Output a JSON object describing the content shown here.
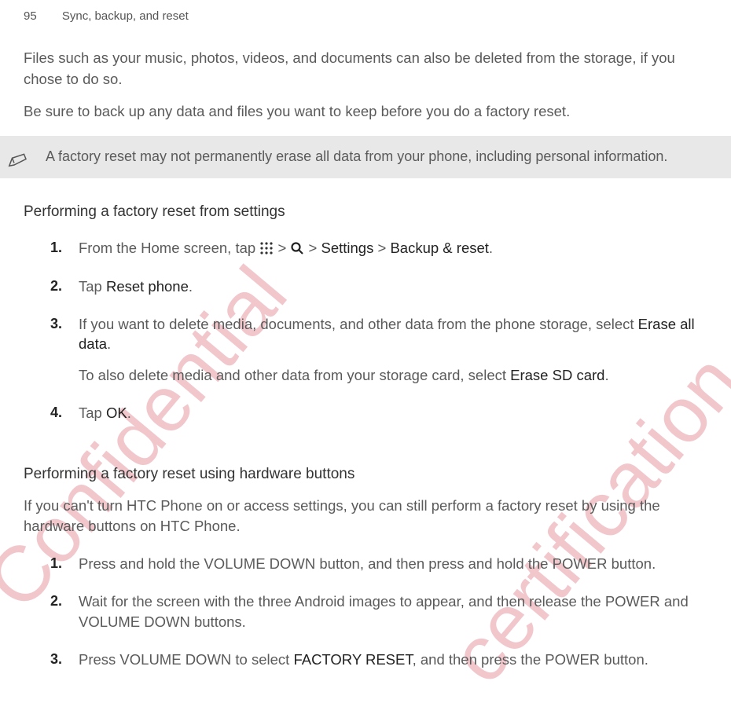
{
  "header": {
    "page_number": "95",
    "section_title": "Sync, backup, and reset"
  },
  "watermarks": {
    "confidential": "Confidential",
    "certification": "certification on"
  },
  "intro": {
    "p1": "Files such as your music, photos, videos, and documents can also be deleted from the storage, if you chose to do so.",
    "p2": "Be sure to back up any data and files you want to keep before you do a factory reset."
  },
  "note": {
    "text": "A factory reset may not permanently erase all data from your phone, including personal information."
  },
  "section1": {
    "heading": "Performing a factory reset from settings",
    "steps": {
      "s1_pre": "From the Home screen, tap ",
      "s1_gt1": " > ",
      "s1_gt2": " > ",
      "s1_settings": "Settings",
      "s1_gt3": " > ",
      "s1_backup": "Backup & reset",
      "s1_end": ".",
      "s2_tap": "Tap ",
      "s2_reset": "Reset phone",
      "s2_end": ".",
      "s3_p1_pre": "If you want to delete media, documents, and other data from the phone storage, select ",
      "s3_p1_bold": "Erase all data",
      "s3_p1_end": ".",
      "s3_p2_pre": "To also delete media and other data from your storage card, select ",
      "s3_p2_bold": "Erase SD card",
      "s3_p2_end": ".",
      "s4_tap": "Tap ",
      "s4_ok": "OK",
      "s4_end": "."
    }
  },
  "section2": {
    "heading": "Performing a factory reset using hardware buttons",
    "intro": "If you can't turn HTC Phone on or access settings, you can still perform a factory reset by using the hardware buttons on HTC Phone.",
    "steps": {
      "s1": "Press and hold the VOLUME DOWN button, and then press and hold the POWER button.",
      "s2": "Wait for the screen with the three Android images to appear, and then release the POWER and VOLUME DOWN buttons.",
      "s3_pre": "Press VOLUME DOWN to select ",
      "s3_bold": "FACTORY RESET",
      "s3_post": ", and then press the POWER button."
    }
  }
}
